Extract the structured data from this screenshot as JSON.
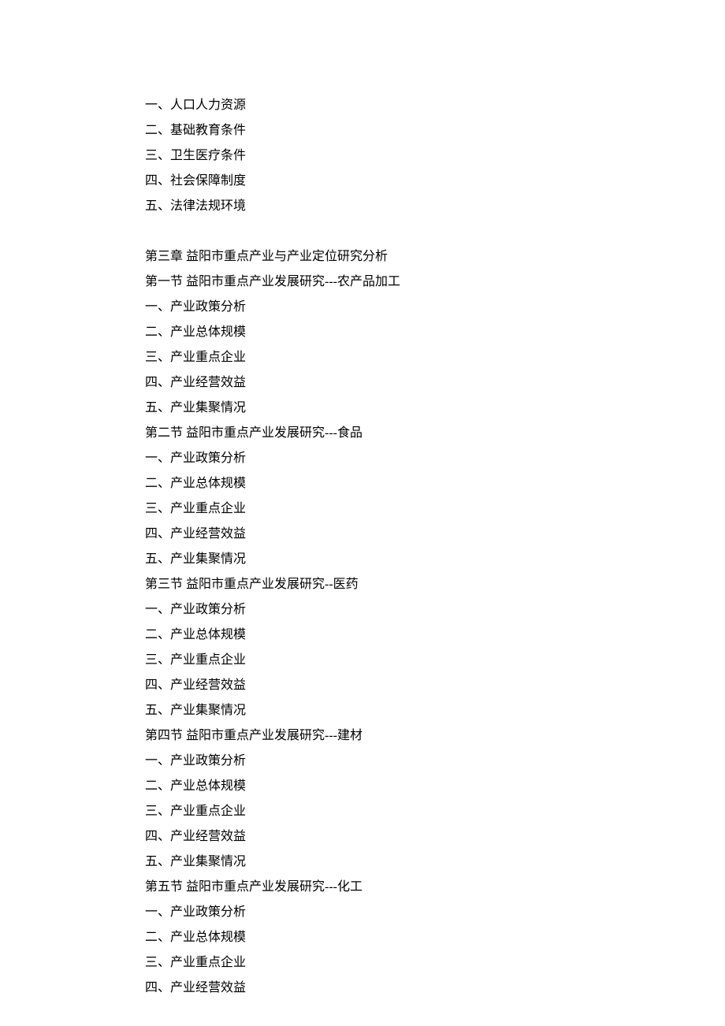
{
  "lines": [
    "一、人口人力资源",
    "二、基础教育条件",
    "三、卫生医疗条件",
    "四、社会保障制度",
    "五、法律法规环境"
  ],
  "chapter3": {
    "title": "第三章  益阳市重点产业与产业定位研究分析",
    "sections": [
      {
        "title": "第一节  益阳市重点产业发展研究---农产品加工",
        "items": [
          "一、产业政策分析",
          "二、产业总体规模",
          "三、产业重点企业",
          "四、产业经营效益",
          "五、产业集聚情况"
        ]
      },
      {
        "title": "第二节  益阳市重点产业发展研究---食品",
        "items": [
          "一、产业政策分析",
          "二、产业总体规模",
          "三、产业重点企业",
          "四、产业经营效益",
          "五、产业集聚情况"
        ]
      },
      {
        "title": "第三节  益阳市重点产业发展研究--医药",
        "items": [
          "一、产业政策分析",
          "二、产业总体规模",
          "三、产业重点企业",
          "四、产业经营效益",
          "五、产业集聚情况"
        ]
      },
      {
        "title": "第四节  益阳市重点产业发展研究---建材",
        "items": [
          "一、产业政策分析",
          "二、产业总体规模",
          "三、产业重点企业",
          "四、产业经营效益",
          "五、产业集聚情况"
        ]
      },
      {
        "title": "第五节  益阳市重点产业发展研究---化工",
        "items": [
          "一、产业政策分析",
          "二、产业总体规模",
          "三、产业重点企业",
          "四、产业经营效益"
        ]
      }
    ]
  }
}
